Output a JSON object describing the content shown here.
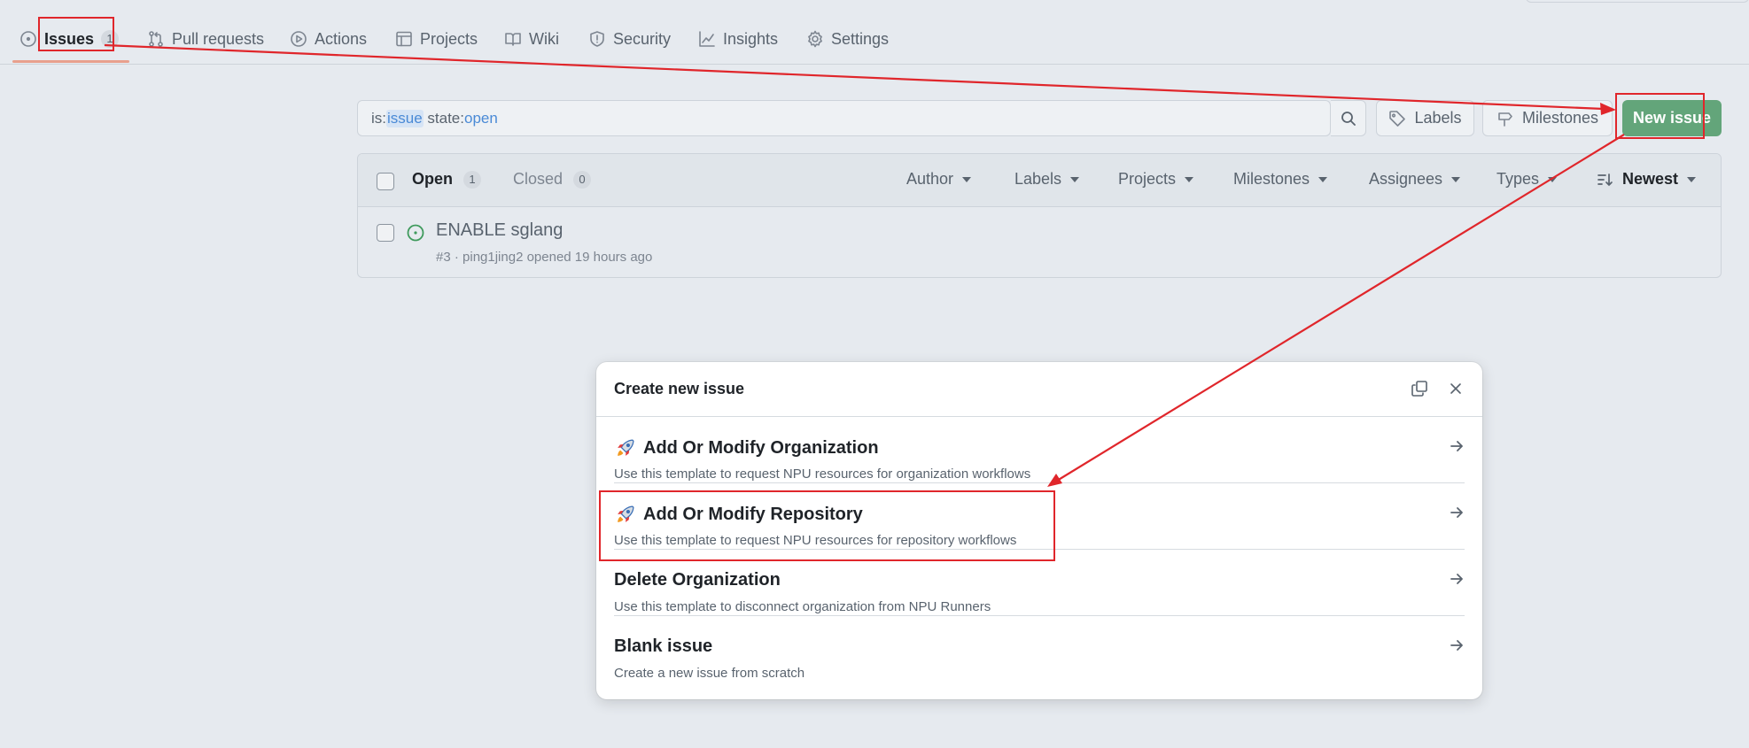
{
  "nav": {
    "tabs": [
      {
        "label": "Issues",
        "count": "1",
        "icon": "issue-opened-icon"
      },
      {
        "label": "Pull requests",
        "icon": "git-pull-request-icon"
      },
      {
        "label": "Actions",
        "icon": "play-icon"
      },
      {
        "label": "Projects",
        "icon": "table-icon"
      },
      {
        "label": "Wiki",
        "icon": "book-icon"
      },
      {
        "label": "Security",
        "icon": "shield-icon"
      },
      {
        "label": "Insights",
        "icon": "graph-icon"
      },
      {
        "label": "Settings",
        "icon": "gear-icon"
      }
    ]
  },
  "search": {
    "prefix1": "is:",
    "value1": "issue",
    "prefix2": " state:",
    "value2": "open"
  },
  "toolbar": {
    "labels": "Labels",
    "milestones": "Milestones",
    "new_issue": "New issue"
  },
  "list": {
    "open_label": "Open",
    "open_count": "1",
    "closed_label": "Closed",
    "closed_count": "0",
    "filters": [
      "Author",
      "Labels",
      "Projects",
      "Milestones",
      "Assignees",
      "Types"
    ],
    "sort": "Newest",
    "issues": [
      {
        "title": "ENABLE sglang",
        "meta": "#3 · ping1jing2 opened 19 hours ago"
      }
    ]
  },
  "modal": {
    "title": "Create new issue",
    "templates": [
      {
        "name": "Add Or Modify Organization",
        "desc": "Use this template to request NPU resources for organization workflows",
        "emoji": true
      },
      {
        "name": "Add Or Modify Repository",
        "desc": "Use this template to request NPU resources for repository workflows",
        "emoji": true
      },
      {
        "name": "Delete Organization",
        "desc": "Use this template to disconnect organization from NPU Runners",
        "emoji": false
      },
      {
        "name": "Blank issue",
        "desc": "Create a new issue from scratch",
        "emoji": false
      }
    ]
  },
  "colors": {
    "primary_button": "#63a57a",
    "annotation": "#e0262b",
    "open_icon": "#3e9a5c"
  }
}
